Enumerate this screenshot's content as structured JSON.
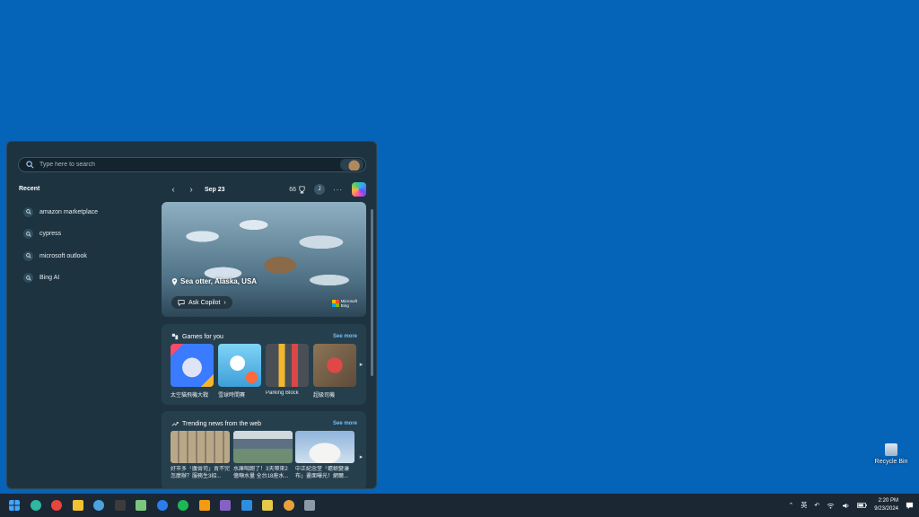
{
  "search": {
    "placeholder": "Type here to search"
  },
  "recent": {
    "title": "Recent",
    "items": [
      {
        "label": "amazon marketplace"
      },
      {
        "label": "cypress"
      },
      {
        "label": "microsoft outlook"
      },
      {
        "label": "Bing AI"
      }
    ]
  },
  "nav": {
    "date": "Sep 23",
    "points": "66",
    "avatar": "J",
    "more": "···"
  },
  "hero": {
    "location": "Sea otter, Alaska, USA",
    "ask": "Ask Copilot",
    "brand_line1": "Microsoft",
    "brand_line2": "Bing"
  },
  "games": {
    "title": "Games for you",
    "see_more": "See more",
    "items": [
      {
        "name": "太空貓飛機大戰",
        "colors": [
          "#3b7bff",
          "#e9f0ff"
        ]
      },
      {
        "name": "雪球時間賽",
        "colors": [
          "#5bc7f0",
          "#e8f7ff"
        ]
      },
      {
        "name": "Parking Block",
        "colors": [
          "#4a4f56",
          "#f0b72f"
        ]
      },
      {
        "name": "超級司機",
        "colors": [
          "#6e5b47",
          "#e04848"
        ]
      }
    ]
  },
  "news": {
    "title": "Trending news from the web",
    "see_more": "See more",
    "items": [
      {
        "caption": "好市多「腹膏司」賣不完怎麼辦？服務生3招...",
        "colors": [
          "#8a7e6c",
          "#d7cdbb"
        ]
      },
      {
        "caption": "水庫喝飽了！3天帶來2億噸水量 全台18座水...",
        "colors": [
          "#5d7182",
          "#9fb7c6"
        ]
      },
      {
        "caption": "中正紀念堂「蟾蜍變瀑布」畫面曝光！網爾...",
        "colors": [
          "#93b5d9",
          "#eef1f4"
        ]
      }
    ]
  },
  "desktop": {
    "recycle_bin": "Recycle Bin"
  },
  "taskbar": {
    "apps": [
      {
        "name": "start-icon",
        "color": "#3fa7ff"
      },
      {
        "name": "edge-icon",
        "color": "#2fb7a1"
      },
      {
        "name": "chrome-icon",
        "color": "#e8453c"
      },
      {
        "name": "file-explorer-icon",
        "color": "#f1c232"
      },
      {
        "name": "app-blue-icon",
        "color": "#4aa3df"
      },
      {
        "name": "terminal-icon",
        "color": "#3c3c3c"
      },
      {
        "name": "notepad-icon",
        "color": "#7bc67e"
      },
      {
        "name": "browser-icon",
        "color": "#2b7de9"
      },
      {
        "name": "spotify-icon",
        "color": "#1db954"
      },
      {
        "name": "search-app-icon",
        "color": "#f39c12"
      },
      {
        "name": "visual-studio-icon",
        "color": "#8661c5"
      },
      {
        "name": "vscode-icon",
        "color": "#2d8ee0"
      },
      {
        "name": "paint-icon",
        "color": "#e6c84a"
      },
      {
        "name": "chrome-canary-icon",
        "color": "#e9a23b"
      },
      {
        "name": "settings-icon",
        "color": "#8a9aa8"
      }
    ],
    "ime": "英",
    "time": "2:20 PM",
    "date": "9/23/2024"
  }
}
